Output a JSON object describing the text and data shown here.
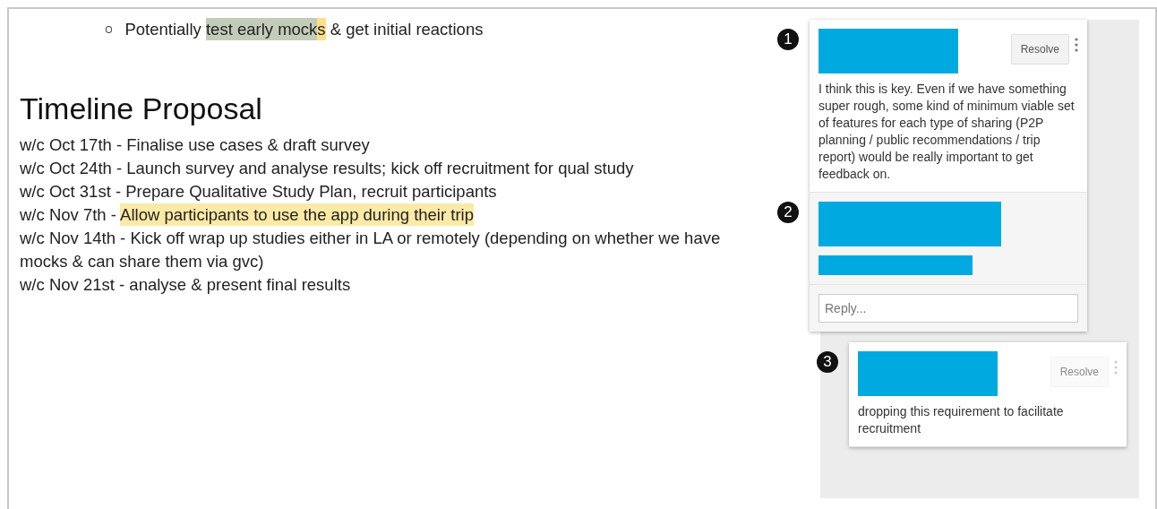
{
  "document": {
    "bullet": {
      "segments": [
        {
          "text": "Potentially "
        },
        {
          "text": "test early mock",
          "color": "#c3ccb9"
        },
        {
          "text": "s",
          "color": "#fbe08a"
        },
        {
          "text": " & get initial reactions"
        }
      ]
    },
    "heading": "Timeline Proposal",
    "lines": [
      {
        "segments": [
          {
            "text": "w/c Oct 17th - Finalise use cases & draft survey"
          }
        ]
      },
      {
        "segments": [
          {
            "text": "w/c Oct 24th - Launch survey and analyse results; kick off recruitment for qual study"
          }
        ]
      },
      {
        "segments": [
          {
            "text": "w/c Oct 31st - Prepare Qualitative Study Plan, recruit participants"
          }
        ]
      },
      {
        "segments": [
          {
            "text": "w/c Nov 7th - "
          },
          {
            "text": "Allow participants to use the app during their trip",
            "color": "#fbeaa6"
          }
        ]
      },
      {
        "segments": [
          {
            "text": "w/c Nov 14th - Kick off wrap up studies either in LA or remotely (depending on whether we have mocks & can share them via gvc)"
          }
        ]
      },
      {
        "segments": [
          {
            "text": "w/c Nov 21st - analyse & present final results"
          }
        ]
      }
    ]
  },
  "threads": [
    {
      "selected": true,
      "comments": [
        {
          "callout": "1",
          "resolve": {
            "label": "Resolve",
            "disabled": false
          },
          "body": "I think this is key. Even if we have something super rough, some kind of minimum viable set of features for each type of sharing (P2P planning / public recommendations / trip report) would be really important to get feedback on."
        },
        {
          "callout": "2"
        }
      ],
      "reply": {
        "placeholder": "Reply..."
      }
    },
    {
      "selected": false,
      "comments": [
        {
          "callout": "3",
          "resolve": {
            "label": "Resolve",
            "disabled": true
          },
          "body": "dropping this requirement to facilitate recruitment"
        }
      ]
    }
  ]
}
